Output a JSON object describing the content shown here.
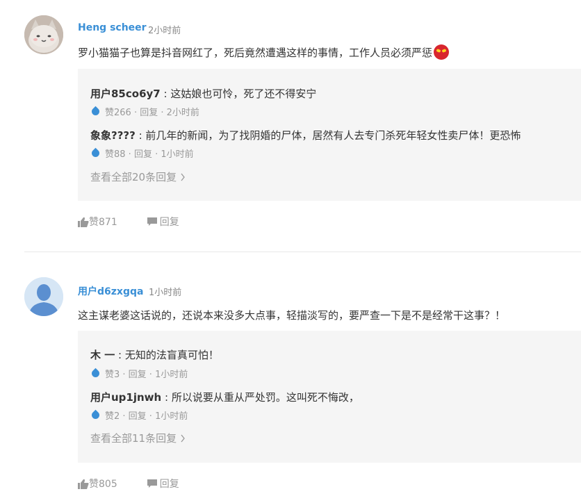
{
  "comments": [
    {
      "username": "Heng scheer",
      "time": "2小时前",
      "text": "罗小猫猫子也算是抖音网红了，死后竟然遭遇这样的事情，工作人员必须严惩",
      "emoji_icon": "angry-face-icon",
      "replies": [
        {
          "name": "用户85co6y7",
          "sep": " : ",
          "text": "这姑娘也可怜，死了还不得安宁",
          "meta": "赞266 · 回复 · 2小时前"
        },
        {
          "name": "象象????",
          "sep": " : ",
          "text": "前几年的新闻，为了找阴婚的尸体，居然有人去专门杀死年轻女性卖尸体！更恐怖",
          "meta": "赞88 · 回复 · 1小时前"
        }
      ],
      "view_all": "查看全部20条回复",
      "likes": "赞871",
      "reply_label": "回复"
    },
    {
      "username": "用户d6zxgqa",
      "time": "1小时前",
      "text": "这主谋老婆这话说的，还说本来没多大点事，轻描淡写的，要严查一下是不是经常干这事？！",
      "replies": [
        {
          "name": "木 一",
          "sep": " : ",
          "text": "无知的法盲真可怕！",
          "meta": "赞3 · 回复 · 1小时前"
        },
        {
          "name": "用户up1jnwh",
          "sep": " : ",
          "text": "所以说要从重从严处罚。这叫死不悔改，",
          "meta": "赞2 · 回复 · 1小时前"
        }
      ],
      "view_all": "查看全部11条回复",
      "likes": "赞805",
      "reply_label": "回复"
    }
  ],
  "colors": {
    "accent": "#3a8fd6",
    "reply_bg": "#f5f5f5",
    "muted": "#999999"
  }
}
